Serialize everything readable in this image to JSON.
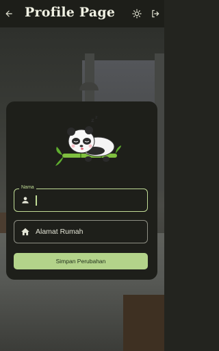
{
  "app_bar": {
    "title": "Profile Page",
    "back_icon": "arrow-left-icon",
    "theme_icon": "sun-icon",
    "logout_icon": "logout-icon"
  },
  "profile_card": {
    "illustration": "sleeping-panda-on-bamboo",
    "name_field": {
      "label": "Nama",
      "value": "",
      "icon": "person-icon"
    },
    "address_field": {
      "placeholder": "Alamat Rumah",
      "value": "",
      "icon": "home-icon"
    },
    "submit_label": "Simpan Perubahan"
  },
  "colors": {
    "accent": "#c2dd97",
    "button": "#b3d38a",
    "surface": "#1e1f1a",
    "appbar": "#1d1e19"
  }
}
